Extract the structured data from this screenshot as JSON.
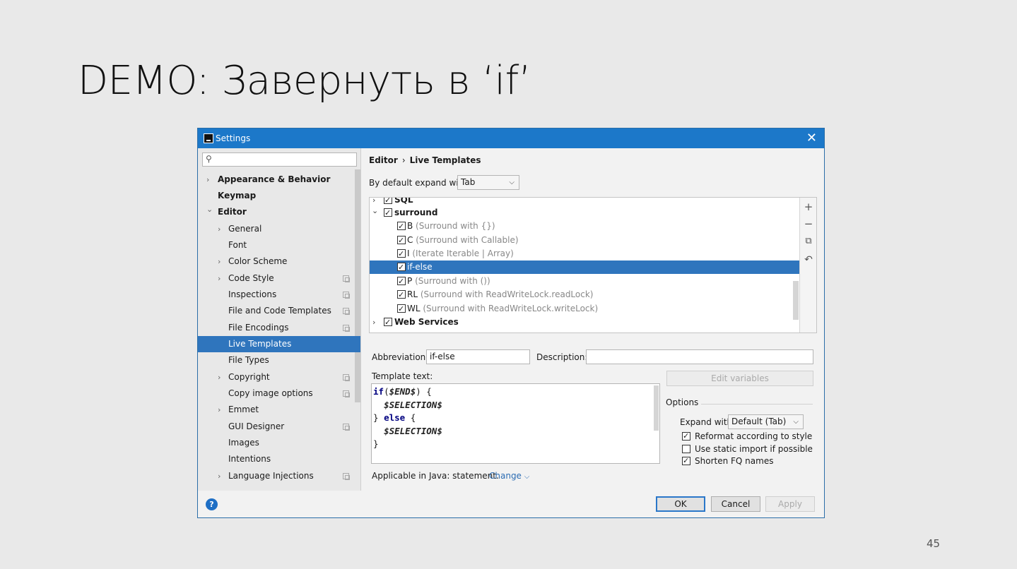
{
  "slide": {
    "title": "DEMO: Завернуть в ‘if’",
    "page_number": "45"
  },
  "dialog": {
    "title": "Settings",
    "close_glyph": "✕"
  },
  "sidebar": {
    "search_placeholder": "",
    "items": [
      {
        "label": "Appearance & Behavior",
        "arrow": "›"
      },
      {
        "label": "Keymap"
      },
      {
        "label": "Editor",
        "arrow": "⌄"
      },
      {
        "label": "General",
        "arrow": "›"
      },
      {
        "label": "Font"
      },
      {
        "label": "Color Scheme",
        "arrow": "›"
      },
      {
        "label": "Code Style",
        "arrow": "›"
      },
      {
        "label": "Inspections"
      },
      {
        "label": "File and Code Templates"
      },
      {
        "label": "File Encodings"
      },
      {
        "label": "Live Templates"
      },
      {
        "label": "File Types"
      },
      {
        "label": "Copyright",
        "arrow": "›"
      },
      {
        "label": "Copy image options"
      },
      {
        "label": "Emmet",
        "arrow": "›"
      },
      {
        "label": "GUI Designer"
      },
      {
        "label": "Images"
      },
      {
        "label": "Intentions"
      },
      {
        "label": "Language Injections",
        "arrow": "›"
      }
    ]
  },
  "content": {
    "breadcrumb": {
      "parent": "Editor",
      "separator": "›",
      "current": "Live Templates"
    },
    "expand_with": {
      "label": "By default expand with",
      "value": "Tab"
    },
    "tree": [
      {
        "name": "SQL",
        "desc": ""
      },
      {
        "name": "surround",
        "desc": ""
      },
      {
        "name": "B",
        "desc": " (Surround with {})"
      },
      {
        "name": "C",
        "desc": " (Surround with Callable)"
      },
      {
        "name": "I",
        "desc": " (Iterate Iterable | Array)"
      },
      {
        "name": "if-else",
        "desc": ""
      },
      {
        "name": "P",
        "desc": " (Surround with ())"
      },
      {
        "name": "RL",
        "desc": " (Surround with ReadWriteLock.readLock)"
      },
      {
        "name": "WL",
        "desc": " (Surround with ReadWriteLock.writeLock)"
      },
      {
        "name": "Web Services",
        "desc": ""
      }
    ],
    "abbreviation": {
      "label": "Abbreviation:",
      "value": "if-else"
    },
    "description": {
      "label": "Description:",
      "value": ""
    },
    "template_text": {
      "label": "Template text:",
      "lines": {
        "l1_kw": "if",
        "l1_a": "(",
        "l1_var": "$END$",
        "l1_b": ") {",
        "l2_var": "$SELECTION$",
        "l3_a": "} ",
        "l3_kw": "else",
        "l3_b": " {",
        "l4_var": "$SELECTION$",
        "l5": "}"
      }
    },
    "edit_variables": "Edit variables",
    "options": {
      "title": "Options",
      "expand_label": "Expand with",
      "expand_value": "Default (Tab)",
      "checks": [
        {
          "label": "Reformat according to style",
          "checked": true
        },
        {
          "label": "Use static import if possible",
          "checked": false
        },
        {
          "label": "Shorten FQ names",
          "checked": true
        }
      ]
    },
    "applicable": {
      "text": "Applicable in Java: statement.",
      "change": "Change"
    }
  },
  "footer": {
    "help": "?",
    "ok": "OK",
    "cancel": "Cancel",
    "apply": "Apply"
  },
  "colors": {
    "accent": "#1c78c9",
    "selection": "#2f75bd",
    "link": "#2b6cb3"
  },
  "tools": [
    "add-icon",
    "remove-icon",
    "copy-icon",
    "restore-icon"
  ]
}
